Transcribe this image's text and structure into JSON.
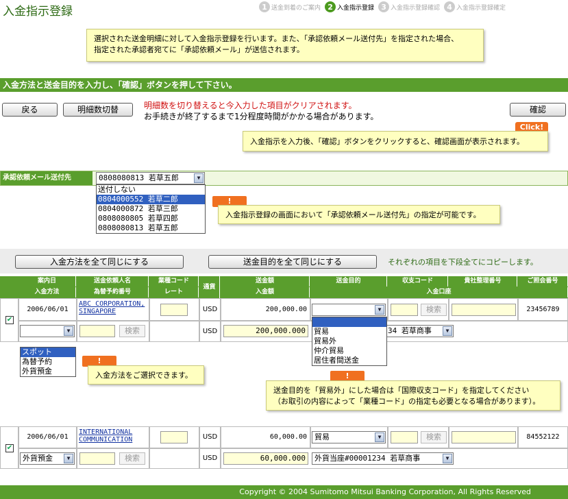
{
  "page_title": "入金指示登録",
  "steps": [
    {
      "num": "1",
      "label": "送金到着のご案内"
    },
    {
      "num": "2",
      "label": "入金指示登録"
    },
    {
      "num": "3",
      "label": "入金指示登録確認"
    },
    {
      "num": "4",
      "label": "入金指示登録確定"
    }
  ],
  "intro_note": [
    "選択された送金明細に対して入金指示登録を行います。また、「承認依頼メール送付先」を指定された場合、",
    "指定された承認者宛てに「承認依頼メール」が送信されます。"
  ],
  "instruction_bar": "入金方法と送金目的を入力し、「確認」ボタンを押して下さい。",
  "buttons": {
    "back": "戻る",
    "toggle_rows": "明細数切替",
    "confirm": "確認",
    "same_method": "入金方法を全て同じにする",
    "same_purpose": "送金目的を全て同じにする"
  },
  "warning": {
    "line1": "明細数を切り替えると今入力した項目がクリアされます。",
    "line2": "お手続きが終了するまで1分程度時間がかかる場合があります。"
  },
  "click_badge": "Click!",
  "confirm_note": "入金指示を入力後、「確認」ボタンをクリックすると、確認画面が表示されます。",
  "approval": {
    "label": "承認依頼メール送付先",
    "selected": "0808080813 若草五郎",
    "options": [
      "送付しない",
      "0804000552 若草二郎",
      "0804000872 若草三郎",
      "0808080805 若草四郎",
      "0808080813 若草五郎"
    ],
    "note": "入金指示登録の画面において「承認依頼メール送付先」の指定が可能です。"
  },
  "bang": "!",
  "copy_note": "それぞれの項目を下段全てにコピーします。",
  "headers": {
    "r1": [
      "案内日",
      "送金依頼人名",
      "業種コード",
      "通貨",
      "送金額",
      "送金目的",
      "収支コード",
      "貴社整理番号",
      "ご照会番号"
    ],
    "r2": [
      "入金方法",
      "為替予約番号",
      "レート",
      "入金額",
      "入金口座"
    ]
  },
  "row1": {
    "date": "2006/06/01",
    "remitter": [
      "ABC CORPORATION,",
      "SINGAPORE"
    ],
    "currency": "USD",
    "amount": "200,000.00",
    "search": "検索",
    "ref": "23456789",
    "amount_in": "200,000.000",
    "account_partial": "34 若草商事",
    "method_options": [
      "スポット",
      "為替予約",
      "外貨預金"
    ],
    "purpose_options": [
      "",
      "貿易",
      "貿易外",
      "仲介貿易",
      "居住者間送金"
    ]
  },
  "method_note": "入金方法をご選択できます。",
  "purpose_note": [
    "送金目的を「貿易外」にした場合は「国際収支コード」を指定してください",
    "（お取引の内容によって「業種コード」の指定も必要となる場合があります）。"
  ],
  "row2": {
    "date": "2006/06/01",
    "remitter": [
      "INTERNATIONAL",
      "COMMUNICATION"
    ],
    "currency": "USD",
    "amount": "60,000.00",
    "purpose": "貿易",
    "search": "検索",
    "ref": "84552122",
    "method": "外貨預金",
    "amount_in": "60,000.000",
    "account": "外貨当座#00001234 若草商事"
  },
  "footer": "Copyright © 2004 Sumitomo Mitsui Banking Corporation, All Rights Reserved"
}
